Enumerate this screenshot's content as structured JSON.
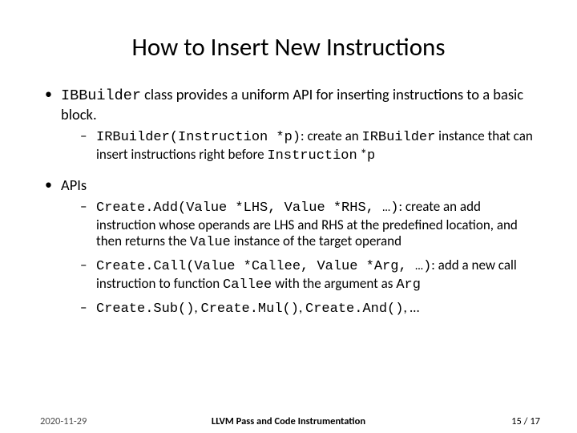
{
  "title": "How to Insert New Instructions",
  "b1_p1": "IBBuilder",
  "b1_p2": " class provides a uniform API for inserting instructions to a basic block.",
  "b1s1_p1": "IRBuilder(Instruction *p)",
  "b1s1_p2": ": create an ",
  "b1s1_p3": "IRBuilder",
  "b1s1_p4": " instance that can insert instructions right before ",
  "b1s1_p5": "Instruction",
  "b1s1_p6": " *",
  "b1s1_p7": "p",
  "b2": "APIs",
  "b2s1_p1": "Create.Add(Value *LHS, Value *RHS, …)",
  "b2s1_p2": ": create an add instruction whose operands are LHS and RHS at the predefined location, and then returns the ",
  "b2s1_p3": "Value",
  "b2s1_p4": " instance of the target operand",
  "b2s2_p1": "Create.Call(Value *Callee, Value *Arg, …)",
  "b2s2_p2": ": add a new call instruction to function ",
  "b2s2_p3": "Callee",
  "b2s2_p4": " with the argument as ",
  "b2s2_p5": "Arg",
  "b2s3_p1": "Create.Sub()",
  "b2s3_p2": ", ",
  "b2s3_p3": "Create.Mul()",
  "b2s3_p4": ", ",
  "b2s3_p5": "Create.And()",
  "b2s3_p6": ", …",
  "footer": {
    "date": "2020-11-29",
    "title": "LLVM Pass and Code Instrumentation",
    "page": "15",
    "sep": " / ",
    "total": "17"
  }
}
